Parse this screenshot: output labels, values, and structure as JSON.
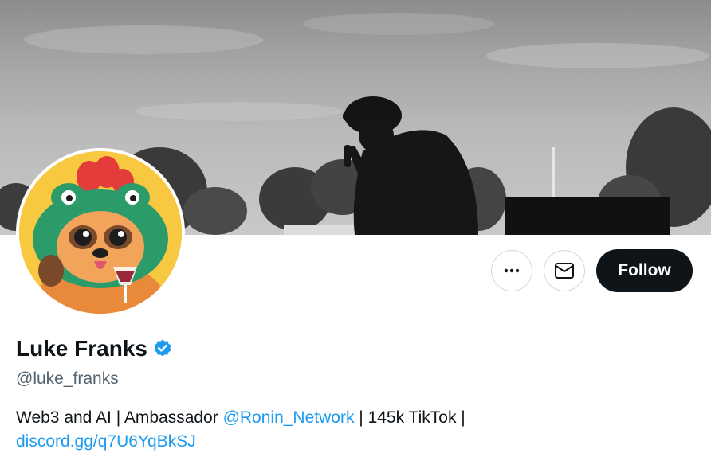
{
  "profile": {
    "display_name": "Luke Franks",
    "handle": "@luke_franks",
    "verified": true,
    "bio": {
      "part1": "Web3 and AI | Ambassador ",
      "mention": "@Ronin_Network",
      "part2": " | 145k TikTok |",
      "link": "discord.gg/q7U6YqBkSJ"
    }
  },
  "actions": {
    "more_icon": "ellipsis-icon",
    "message_icon": "envelope-icon",
    "follow_label": "Follow"
  },
  "colors": {
    "accent": "#1d9bf0",
    "follow_bg": "#0f1419",
    "handle_text": "#536471",
    "button_border": "#cfd9de"
  }
}
